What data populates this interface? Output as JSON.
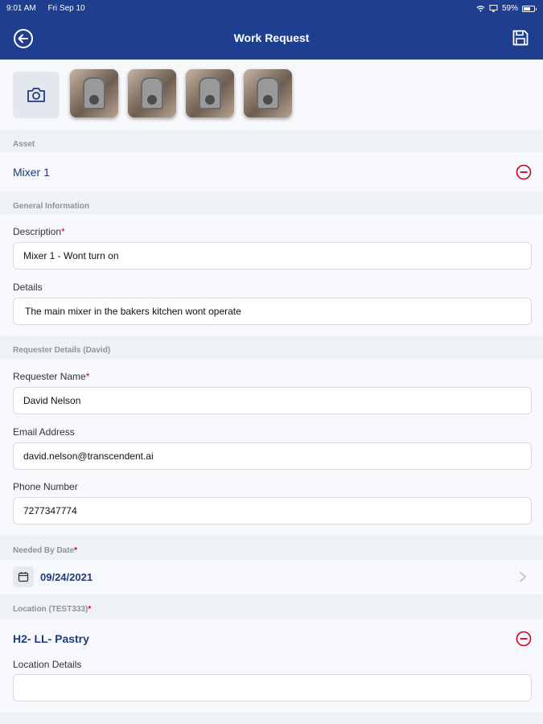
{
  "status_bar": {
    "time": "9:01 AM",
    "date": "Fri Sep 10",
    "battery": "59%"
  },
  "header": {
    "title": "Work Request",
    "back_icon": "back-circle-icon",
    "save_icon": "save-icon"
  },
  "photos": {
    "camera_icon": "camera-icon",
    "thumbnails": [
      "mixer-photo-1",
      "mixer-photo-2",
      "mixer-photo-3",
      "mixer-photo-4"
    ]
  },
  "asset": {
    "section_label": "Asset",
    "name": "Mixer 1"
  },
  "general": {
    "section_label": "General Information",
    "description_label": "Description",
    "description_value": "Mixer 1 - Wont turn on",
    "details_label": "Details",
    "details_value": "The main mixer in the bakers kitchen wont operate"
  },
  "requester": {
    "section_label": "Requester Details (David)",
    "name_label": "Requester Name",
    "name_value": "David Nelson",
    "email_label": "Email Address",
    "email_value": "david.nelson@transcendent.ai",
    "phone_label": "Phone Number",
    "phone_value": "7277347774"
  },
  "needed_by": {
    "section_label": "Needed By Date",
    "date": "09/24/2021"
  },
  "location": {
    "section_label": "Location (TEST333)",
    "name": "H2- LL- Pastry",
    "details_label": "Location Details",
    "details_value": ""
  },
  "colors": {
    "header_bg": "#1f3e8f",
    "accent_text": "#1f3a7f",
    "required": "#d0021b",
    "remove": "#d0021b"
  }
}
